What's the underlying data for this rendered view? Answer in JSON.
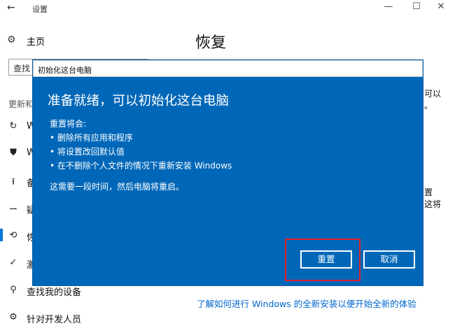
{
  "window": {
    "back_glyph": "←",
    "title": "设置",
    "minimize_glyph": "—",
    "maximize_glyph": "☐",
    "close_glyph": "✕"
  },
  "sidebar": {
    "home_label": "主页",
    "search_placeholder_visible": "查找",
    "section_header": "更新和",
    "items": [
      {
        "icon": "refresh-icon",
        "glyph": "↻",
        "label": "W"
      },
      {
        "icon": "shield-icon",
        "glyph": "⛊",
        "label": "W"
      },
      {
        "icon": "backup-icon",
        "glyph": "⭱",
        "label": "备"
      },
      {
        "icon": "wrench-icon",
        "glyph": "🔧",
        "label": "疑"
      },
      {
        "icon": "recovery-icon",
        "glyph": "⟲",
        "label": "恢"
      },
      {
        "icon": "activation-icon",
        "glyph": "✓",
        "label": "激"
      },
      {
        "icon": "person-location-icon",
        "glyph": "⚲",
        "label": "查找我的设备"
      },
      {
        "icon": "developer-icon",
        "glyph": "⚙",
        "label": "针对开发人员"
      }
    ]
  },
  "main": {
    "title": "恢复",
    "right_fragments": [
      "可以",
      "。",
      "置",
      "这将"
    ],
    "bottom_link": "了解如何进行 Windows 的全新安装以便开始全新的体验"
  },
  "dialog": {
    "title": "初始化这台电脑",
    "heading": "准备就绪，可以初始化这台电脑",
    "intro": "重置将会:",
    "bullets": [
      "• 删除所有应用和程序",
      "• 将设置改回默认值",
      "• 在不删除个人文件的情况下重新安装 Windows"
    ],
    "note": "这需要一段时间，然后电脑将重启。",
    "reset_button": "重置",
    "cancel_button": "取消"
  },
  "colors": {
    "dialog_bg": "#0067b8",
    "accent": "#0078d7",
    "link": "#0066cc",
    "highlight": "#e0202c"
  }
}
